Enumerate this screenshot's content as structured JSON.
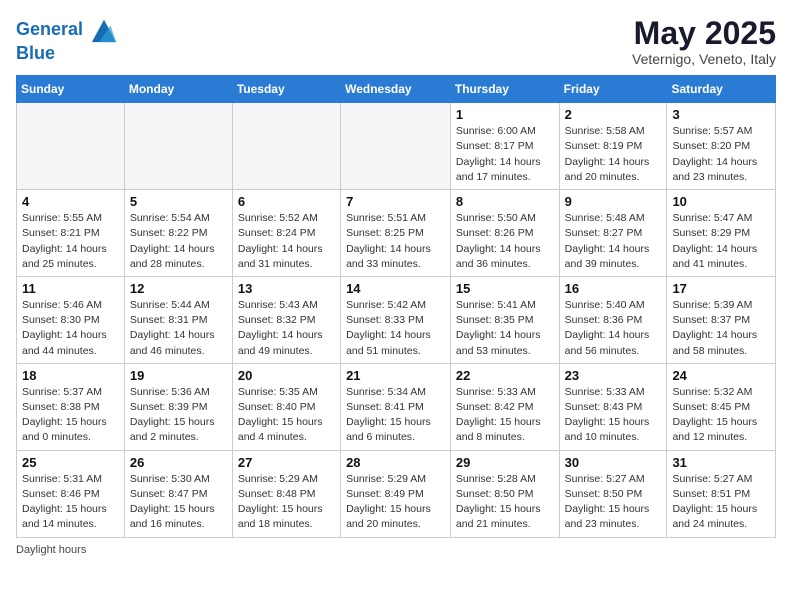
{
  "header": {
    "logo_line1": "General",
    "logo_line2": "Blue",
    "title": "May 2025",
    "subtitle": "Veternigo, Veneto, Italy"
  },
  "days_of_week": [
    "Sunday",
    "Monday",
    "Tuesday",
    "Wednesday",
    "Thursday",
    "Friday",
    "Saturday"
  ],
  "weeks": [
    [
      {
        "day": "",
        "info": ""
      },
      {
        "day": "",
        "info": ""
      },
      {
        "day": "",
        "info": ""
      },
      {
        "day": "",
        "info": ""
      },
      {
        "day": "1",
        "info": "Sunrise: 6:00 AM\nSunset: 8:17 PM\nDaylight: 14 hours\nand 17 minutes."
      },
      {
        "day": "2",
        "info": "Sunrise: 5:58 AM\nSunset: 8:19 PM\nDaylight: 14 hours\nand 20 minutes."
      },
      {
        "day": "3",
        "info": "Sunrise: 5:57 AM\nSunset: 8:20 PM\nDaylight: 14 hours\nand 23 minutes."
      }
    ],
    [
      {
        "day": "4",
        "info": "Sunrise: 5:55 AM\nSunset: 8:21 PM\nDaylight: 14 hours\nand 25 minutes."
      },
      {
        "day": "5",
        "info": "Sunrise: 5:54 AM\nSunset: 8:22 PM\nDaylight: 14 hours\nand 28 minutes."
      },
      {
        "day": "6",
        "info": "Sunrise: 5:52 AM\nSunset: 8:24 PM\nDaylight: 14 hours\nand 31 minutes."
      },
      {
        "day": "7",
        "info": "Sunrise: 5:51 AM\nSunset: 8:25 PM\nDaylight: 14 hours\nand 33 minutes."
      },
      {
        "day": "8",
        "info": "Sunrise: 5:50 AM\nSunset: 8:26 PM\nDaylight: 14 hours\nand 36 minutes."
      },
      {
        "day": "9",
        "info": "Sunrise: 5:48 AM\nSunset: 8:27 PM\nDaylight: 14 hours\nand 39 minutes."
      },
      {
        "day": "10",
        "info": "Sunrise: 5:47 AM\nSunset: 8:29 PM\nDaylight: 14 hours\nand 41 minutes."
      }
    ],
    [
      {
        "day": "11",
        "info": "Sunrise: 5:46 AM\nSunset: 8:30 PM\nDaylight: 14 hours\nand 44 minutes."
      },
      {
        "day": "12",
        "info": "Sunrise: 5:44 AM\nSunset: 8:31 PM\nDaylight: 14 hours\nand 46 minutes."
      },
      {
        "day": "13",
        "info": "Sunrise: 5:43 AM\nSunset: 8:32 PM\nDaylight: 14 hours\nand 49 minutes."
      },
      {
        "day": "14",
        "info": "Sunrise: 5:42 AM\nSunset: 8:33 PM\nDaylight: 14 hours\nand 51 minutes."
      },
      {
        "day": "15",
        "info": "Sunrise: 5:41 AM\nSunset: 8:35 PM\nDaylight: 14 hours\nand 53 minutes."
      },
      {
        "day": "16",
        "info": "Sunrise: 5:40 AM\nSunset: 8:36 PM\nDaylight: 14 hours\nand 56 minutes."
      },
      {
        "day": "17",
        "info": "Sunrise: 5:39 AM\nSunset: 8:37 PM\nDaylight: 14 hours\nand 58 minutes."
      }
    ],
    [
      {
        "day": "18",
        "info": "Sunrise: 5:37 AM\nSunset: 8:38 PM\nDaylight: 15 hours\nand 0 minutes."
      },
      {
        "day": "19",
        "info": "Sunrise: 5:36 AM\nSunset: 8:39 PM\nDaylight: 15 hours\nand 2 minutes."
      },
      {
        "day": "20",
        "info": "Sunrise: 5:35 AM\nSunset: 8:40 PM\nDaylight: 15 hours\nand 4 minutes."
      },
      {
        "day": "21",
        "info": "Sunrise: 5:34 AM\nSunset: 8:41 PM\nDaylight: 15 hours\nand 6 minutes."
      },
      {
        "day": "22",
        "info": "Sunrise: 5:33 AM\nSunset: 8:42 PM\nDaylight: 15 hours\nand 8 minutes."
      },
      {
        "day": "23",
        "info": "Sunrise: 5:33 AM\nSunset: 8:43 PM\nDaylight: 15 hours\nand 10 minutes."
      },
      {
        "day": "24",
        "info": "Sunrise: 5:32 AM\nSunset: 8:45 PM\nDaylight: 15 hours\nand 12 minutes."
      }
    ],
    [
      {
        "day": "25",
        "info": "Sunrise: 5:31 AM\nSunset: 8:46 PM\nDaylight: 15 hours\nand 14 minutes."
      },
      {
        "day": "26",
        "info": "Sunrise: 5:30 AM\nSunset: 8:47 PM\nDaylight: 15 hours\nand 16 minutes."
      },
      {
        "day": "27",
        "info": "Sunrise: 5:29 AM\nSunset: 8:48 PM\nDaylight: 15 hours\nand 18 minutes."
      },
      {
        "day": "28",
        "info": "Sunrise: 5:29 AM\nSunset: 8:49 PM\nDaylight: 15 hours\nand 20 minutes."
      },
      {
        "day": "29",
        "info": "Sunrise: 5:28 AM\nSunset: 8:50 PM\nDaylight: 15 hours\nand 21 minutes."
      },
      {
        "day": "30",
        "info": "Sunrise: 5:27 AM\nSunset: 8:50 PM\nDaylight: 15 hours\nand 23 minutes."
      },
      {
        "day": "31",
        "info": "Sunrise: 5:27 AM\nSunset: 8:51 PM\nDaylight: 15 hours\nand 24 minutes."
      }
    ]
  ],
  "footer": "Daylight hours"
}
